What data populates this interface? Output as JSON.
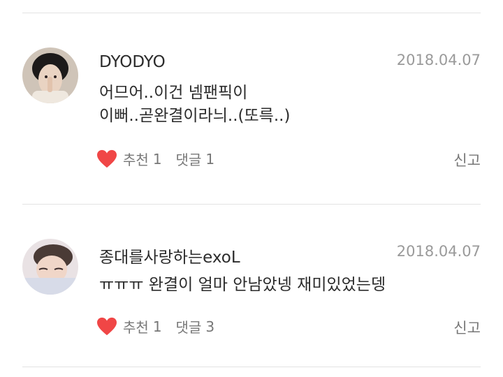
{
  "comments": [
    {
      "author": "DYODYO",
      "date": "2018.04.07",
      "lines": [
        "어므어..이건 넴팬픽이",
        "이뻐..곧완결이라늬..(또륵..)"
      ],
      "like_label": "추천",
      "like_count": "1",
      "reply_label": "댓글",
      "reply_count": "1",
      "report_label": "신고",
      "heart_color": "#f04646"
    },
    {
      "author": "종대를사랑하는exoL",
      "date": "2018.04.07",
      "lines": [
        "ㅠㅠㅠ 완결이 얼마 안남았넹 재미있었는뎅"
      ],
      "like_label": "추천",
      "like_count": "1",
      "reply_label": "댓글",
      "reply_count": "3",
      "report_label": "신고",
      "heart_color": "#f04646"
    }
  ]
}
